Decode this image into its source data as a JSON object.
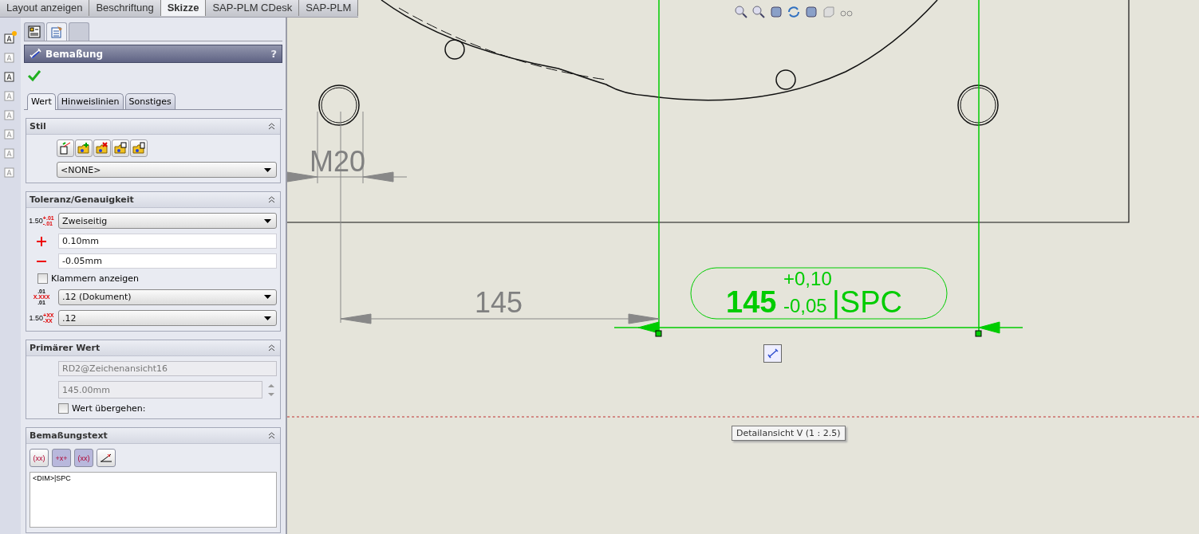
{
  "command_tabs": [
    {
      "label": "Layout anzeigen",
      "selected": false
    },
    {
      "label": "Beschriftung",
      "selected": false
    },
    {
      "label": "Skizze",
      "selected": true
    },
    {
      "label": "SAP-PLM CDesk",
      "selected": false
    },
    {
      "label": "SAP-PLM",
      "selected": false
    }
  ],
  "panel": {
    "title": "Bemaßung",
    "help": "?",
    "tabs": [
      {
        "label": "Wert",
        "selected": true
      },
      {
        "label": "Hinweislinien",
        "selected": false
      },
      {
        "label": "Sonstiges",
        "selected": false
      }
    ],
    "style_section": {
      "title": "Stil",
      "dropdown": "<NONE>"
    },
    "tolerance_section": {
      "title": "Toleranz/Genauigkeit",
      "tolerance_icon": {
        "base": "1.50",
        "upper": "+.01",
        "lower": "-.01"
      },
      "type_dropdown": "Zweiseitig",
      "plus_field": "0.10mm",
      "minus_field": "-0.05mm",
      "brackets": {
        "label": "Klammern anzeigen",
        "checked": false
      },
      "precision_icon": {
        "upper": ".01",
        "main": "X.XXX",
        "lower": ".01"
      },
      "precision_dropdown": ".12 (Dokument)",
      "tolerance_precision_icon": {
        "base": "1.50",
        "upper": "+XX",
        "lower": "-XX"
      },
      "tolerance_precision_dropdown": ".12"
    },
    "primary_section": {
      "title": "Primärer Wert",
      "name_field": "RD2@Zeichenansicht16",
      "value_field": "145.00mm",
      "override": {
        "label": "Wert übergehen:",
        "checked": false
      }
    },
    "text_section": {
      "title": "Bemaßungstext",
      "buttons": [
        {
          "kind": "text",
          "label": "(xx)",
          "selected": false
        },
        {
          "kind": "text",
          "label": "+x+",
          "selected": true
        },
        {
          "kind": "text",
          "label": "(xx)",
          "selected": true
        },
        {
          "kind": "icon",
          "selected": false
        }
      ],
      "text": "<DIM>|SPC"
    }
  },
  "drawing": {
    "hole_label": "M20",
    "reference_dimension": "145",
    "selected_dimension": {
      "value": "145",
      "upper_tolerance": "+0,10",
      "lower_tolerance": "-0,05",
      "suffix": "|SPC"
    },
    "view_tooltip": "Detailansicht V (1 : 2.5)"
  }
}
